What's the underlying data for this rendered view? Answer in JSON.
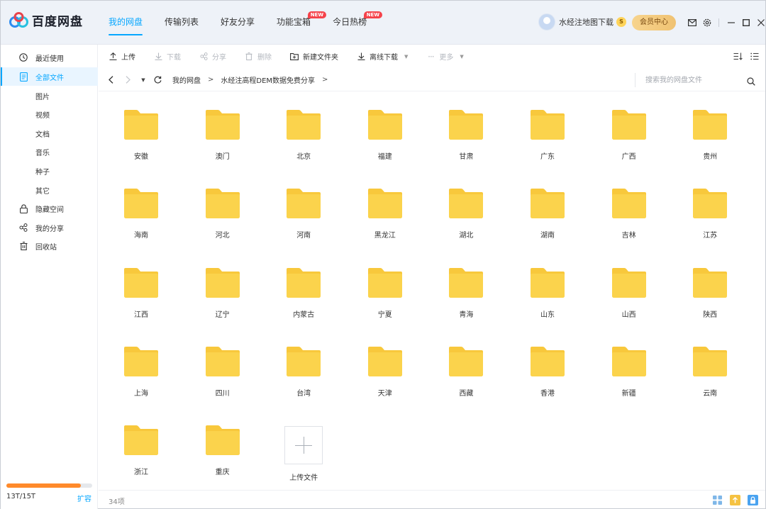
{
  "app": {
    "logo_text": "百度网盘"
  },
  "nav": {
    "tabs": [
      {
        "label": "我的网盘",
        "active": true
      },
      {
        "label": "传输列表"
      },
      {
        "label": "好友分享"
      },
      {
        "label": "功能宝箱",
        "badge": "NEW"
      },
      {
        "label": "今日热榜",
        "badge": "NEW"
      }
    ]
  },
  "user": {
    "name": "水经注地图下载",
    "vip_badge": "S",
    "member_button": "会员中心"
  },
  "sidebar": {
    "items": [
      {
        "label": "最近使用",
        "icon": "clock-icon"
      },
      {
        "label": "全部文件",
        "icon": "file-icon",
        "active": true
      },
      {
        "label": "图片"
      },
      {
        "label": "视频"
      },
      {
        "label": "文档"
      },
      {
        "label": "音乐"
      },
      {
        "label": "种子"
      },
      {
        "label": "其它"
      },
      {
        "label": "隐藏空间",
        "icon": "lock-icon"
      },
      {
        "label": "我的分享",
        "icon": "share-icon"
      },
      {
        "label": "回收站",
        "icon": "trash-icon"
      }
    ],
    "quota": {
      "text": "13T/15T",
      "used_fraction": 0.8667,
      "expand": "扩容"
    }
  },
  "toolbar": {
    "upload": "上传",
    "download": "下载",
    "share": "分享",
    "delete": "删除",
    "new_folder": "新建文件夹",
    "offline_download": "离线下载",
    "more": "更多"
  },
  "breadcrumb": {
    "items": [
      "我的网盘",
      "水经注高程DEM数据免费分享"
    ]
  },
  "search": {
    "placeholder": "搜索我的网盘文件"
  },
  "folders": [
    "安徽",
    "澳门",
    "北京",
    "福建",
    "甘肃",
    "广东",
    "广西",
    "贵州",
    "海南",
    "河北",
    "河南",
    "黑龙江",
    "湖北",
    "湖南",
    "吉林",
    "江苏",
    "江西",
    "辽宁",
    "内蒙古",
    "宁夏",
    "青海",
    "山东",
    "山西",
    "陕西",
    "上海",
    "四川",
    "台湾",
    "天津",
    "西藏",
    "香港",
    "新疆",
    "云南",
    "浙江",
    "重庆"
  ],
  "upload_tile": {
    "label": "上传文件"
  },
  "footer": {
    "item_count": "34项"
  },
  "colors": {
    "accent": "#06a7ff",
    "folder": "#f8c83c",
    "quota": "#ff8a2b"
  }
}
